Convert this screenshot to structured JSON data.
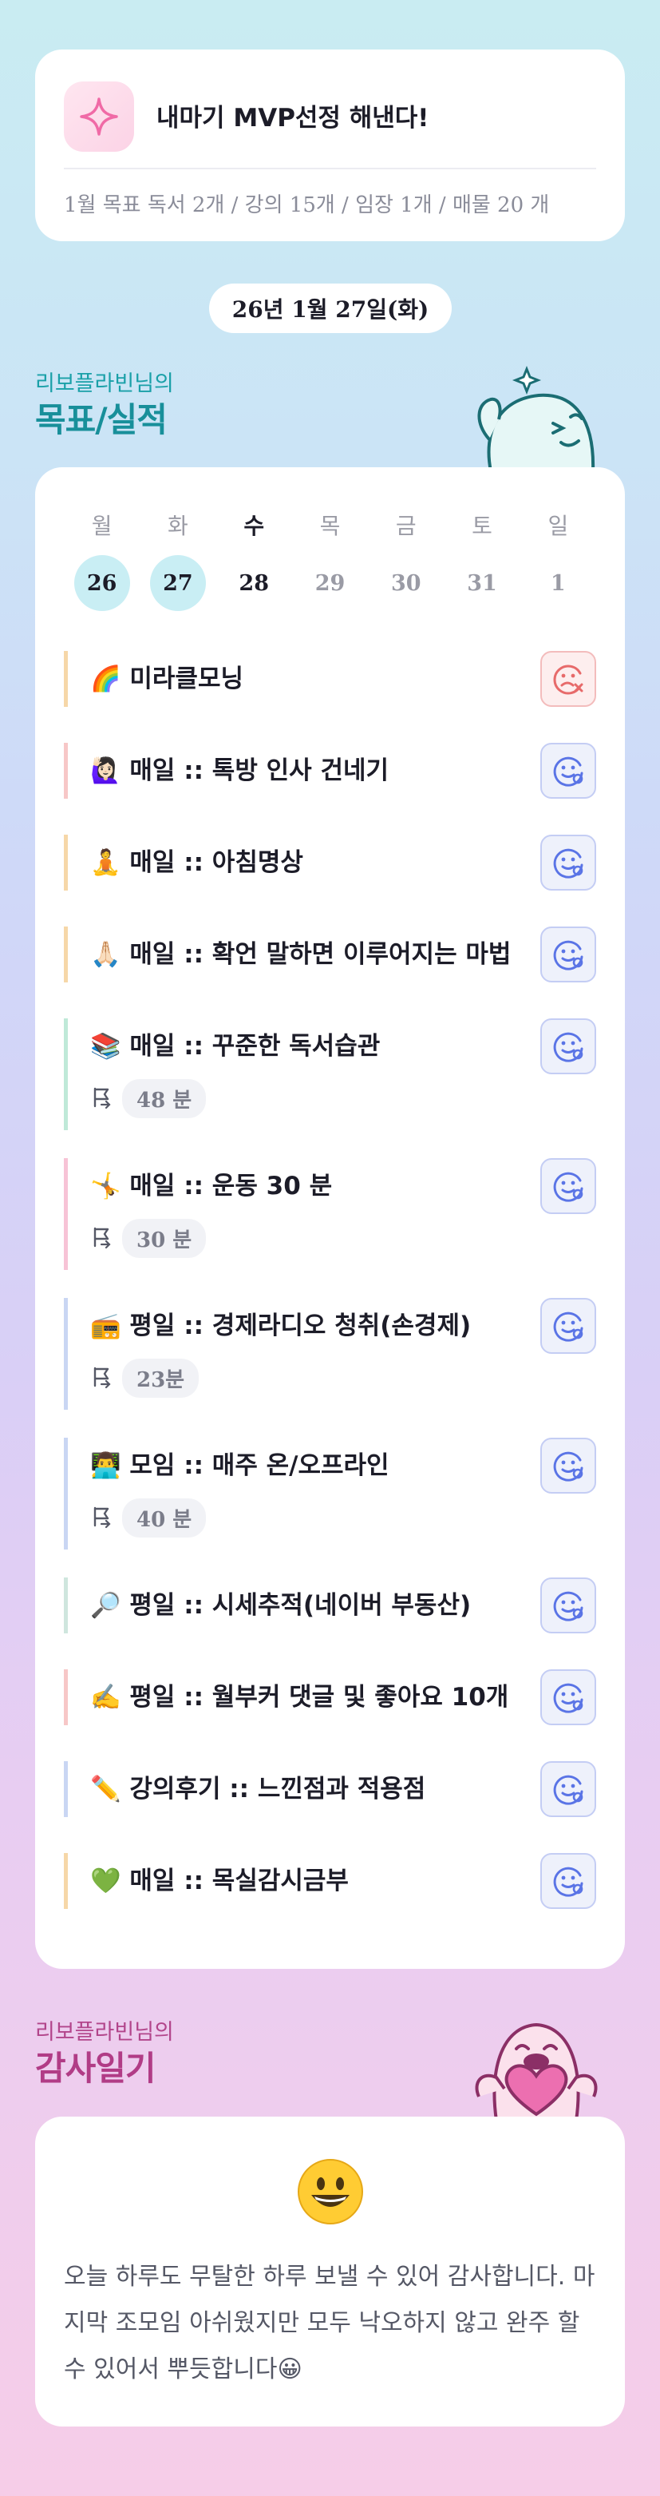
{
  "top": {
    "main_goal": "내마기 MVP선정 해낸다!",
    "month_goal": "1월 목표   독서 2개 / 강의 15개 / 임장 1개 / 매물 20 개"
  },
  "date": "26년 1월 27일(화)",
  "goals_section": {
    "user": "리보플라빈님의",
    "title": "목표/실적"
  },
  "week": {
    "weekdays": [
      "월",
      "화",
      "수",
      "목",
      "금",
      "토",
      "일"
    ],
    "days": [
      "26",
      "27",
      "28",
      "29",
      "30",
      "31",
      "1"
    ]
  },
  "goals": [
    {
      "title": "🌈 미라클모닝",
      "status": "fail",
      "color": "#f6d7a8"
    },
    {
      "title": "🙋🏻‍♀️ 매일 :: 톡방 인사 건네기",
      "status": "pending",
      "color": "#f7c7c7"
    },
    {
      "title": "🧘 매일 :: 아침명상",
      "status": "pending",
      "color": "#f6d7a8"
    },
    {
      "title": "🙏🏻 매일 :: 확언 말하면 이루어지는 마법",
      "status": "pending",
      "color": "#f6d7a8"
    },
    {
      "title": "📚 매일 :: 꾸준한 독서습관",
      "time": "48 분",
      "status": "pending",
      "color": "#bfe9d8"
    },
    {
      "title": "🤸 매일 :: 운동 30 분",
      "time": "30 분",
      "status": "pending",
      "color": "#f7c3d6"
    },
    {
      "title": "📻 평일 :: 경제라디오 청취(손경제)",
      "time": "23분",
      "status": "pending",
      "color": "#c9d6f3"
    },
    {
      "title": "👨‍💻 모임 :: 매주 온/오프라인",
      "time": "40 분",
      "status": "pending",
      "color": "#c9d6f3"
    },
    {
      "title": "🔎 평일 :: 시세추적(네이버 부동산)",
      "status": "pending",
      "color": "#cfe6de"
    },
    {
      "title": "✍️ 평일 :: 월부커 댓글 및 좋아요 10개",
      "status": "pending",
      "color": "#f7c7c7"
    },
    {
      "title": "✏️ 강의후기 :: 느낀점과 적용점",
      "status": "pending",
      "color": "#c9d6f3"
    },
    {
      "title": "💚 매일 :: 목실감시금부",
      "status": "pending",
      "color": "#f6d7a8"
    }
  ],
  "gratitude_section": {
    "user": "리보플라빈님의",
    "title": "감사일기"
  },
  "gratitude": {
    "emoji": "grinning-face-icon",
    "text": "오늘 하루도 무탈한 하루 보낼 수 있어 감사합니다. 마지막 조모임 아쉬웠지만 모두 낙오하지 않고 완주 할 수 있어서 뿌듯합니다😀"
  },
  "colors": {
    "accent_teal": "#188f9a",
    "accent_pink": "#b13c86",
    "today_circle": "#c9eef4"
  }
}
